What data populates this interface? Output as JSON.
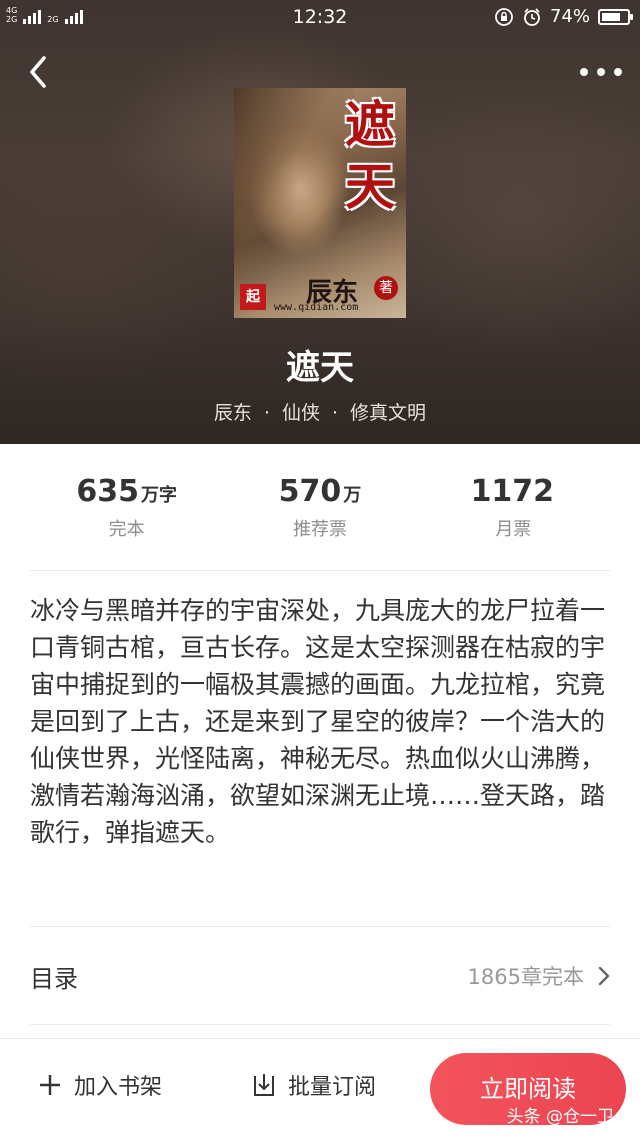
{
  "status_bar": {
    "network_top": "4G",
    "network_bottom": "2G",
    "network_extra": "2G",
    "time": "12:32",
    "battery_percent": "74%",
    "battery_level": 0.74
  },
  "book": {
    "cover": {
      "title_chars": [
        "遮",
        "天"
      ],
      "author": "辰东",
      "author_badge": "著",
      "logo": "起",
      "url": "www.qidian.com"
    },
    "title": "遮天",
    "author": "辰东",
    "genre": "仙侠",
    "subgenre": "修真文明",
    "separator": "·"
  },
  "stats": [
    {
      "value": "635",
      "unit": "万字",
      "label": "完本"
    },
    {
      "value": "570",
      "unit": "万",
      "label": "推荐票"
    },
    {
      "value": "1172",
      "unit": "",
      "label": "月票"
    }
  ],
  "description": "冰冷与黑暗并存的宇宙深处，九具庞大的龙尸拉着一口青铜古棺，亘古长存。这是太空探测器在枯寂的宇宙中捕捉到的一幅极其震撼的画面。九龙拉棺，究竟是回到了上古，还是来到了星空的彼岸？一个浩大的仙侠世界，光怪陆离，神秘无尽。热血似火山沸腾，激情若瀚海汹涌，欲望如深渊无止境……登天路，踏歌行，弹指遮天。",
  "toc": {
    "label": "目录",
    "info": "1865章完本"
  },
  "bottom_bar": {
    "add_shelf": "加入书架",
    "batch_subscribe": "批量订阅",
    "read_now": "立即阅读"
  },
  "watermark": "头条 @仓一卫",
  "colors": {
    "accent": "#f0505a",
    "header_bg": "#42362f"
  }
}
